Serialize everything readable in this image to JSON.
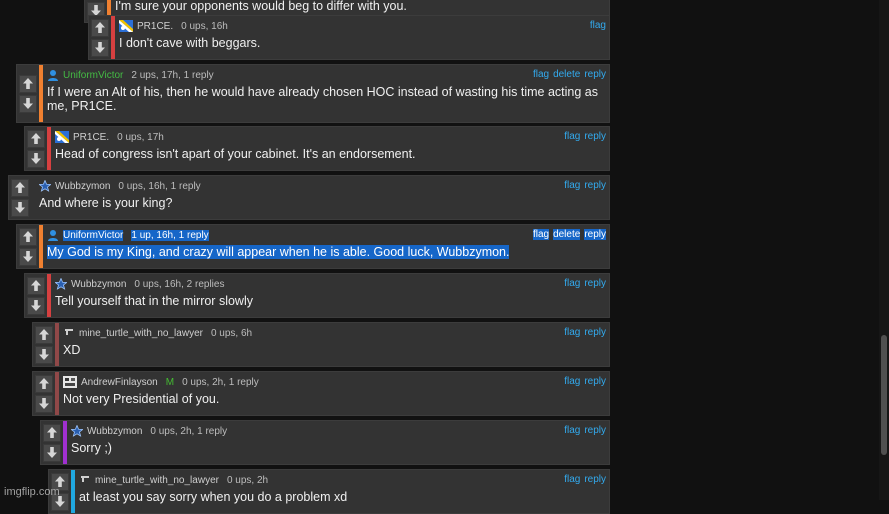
{
  "colors": {
    "background": "#111111",
    "card": "#333333",
    "link": "#33aaee",
    "highlight": "#1666c8",
    "username_uv": "#44bb44",
    "bar_orange": "#f08030",
    "bar_red": "#d64040",
    "bar_darkred": "#904848",
    "bar_purple": "#a030d0",
    "bar_cyan": "#20a8e0"
  },
  "comments": [
    {
      "username": "",
      "stats": "",
      "text": "I'm sure your opponents would beg to differ with you.",
      "actions": []
    },
    {
      "username": "PR1CE.",
      "icon": "flag-avatar-icon",
      "stats": "0 ups, 16h",
      "text": "I don't cave with beggars.",
      "actions": [
        "flag"
      ]
    },
    {
      "username": "UniformVictor",
      "icon": "user-icon",
      "stats": "2 ups, 17h, 1 reply",
      "text": "If I were an Alt of his, then he would have already chosen HOC instead of wasting his time acting as me, PR1CE.",
      "actions": [
        "flag",
        "delete",
        "reply"
      ]
    },
    {
      "username": "PR1CE.",
      "icon": "flag-avatar-icon",
      "stats": "0 ups, 17h",
      "text": "Head of congress isn't apart of your cabinet. It's an endorsement.",
      "actions": [
        "flag",
        "reply"
      ]
    },
    {
      "username": "Wubbzymon",
      "icon": "star-avatar-icon",
      "stats": "0 ups, 16h, 1 reply",
      "text": "And where is your king?",
      "actions": [
        "flag",
        "reply"
      ]
    },
    {
      "username": "UniformVictor",
      "icon": "user-icon",
      "stats": "1 up, 16h, 1 reply",
      "text": "My God is my King, and crazy will appear when he is able. Good luck, Wubbzymon.",
      "actions": [
        "flag",
        "delete",
        "reply"
      ],
      "highlighted": true
    },
    {
      "username": "Wubbzymon",
      "icon": "star-avatar-icon",
      "stats": "0 ups, 16h, 2 replies",
      "text": "Tell yourself that in the mirror slowly",
      "actions": [
        "flag",
        "reply"
      ]
    },
    {
      "username": "mine_turtle_with_no_lawyer",
      "icon": "gun-avatar-icon",
      "stats": "0 ups, 6h",
      "text": "XD",
      "actions": [
        "flag",
        "reply"
      ]
    },
    {
      "username": "AndrewFinlayson",
      "icon": "comic-avatar-icon",
      "badge": "M",
      "stats": "0 ups, 2h, 1 reply",
      "text": "Not very Presidential of you.",
      "actions": [
        "flag",
        "reply"
      ]
    },
    {
      "username": "Wubbzymon",
      "icon": "star-avatar-icon",
      "stats": "0 ups, 2h, 1 reply",
      "text": "Sorry ;)",
      "actions": [
        "flag",
        "reply"
      ]
    },
    {
      "username": "mine_turtle_with_no_lawyer",
      "icon": "gun-avatar-icon",
      "stats": "0 ups, 2h",
      "text": "at least you say sorry when you do a problem xd",
      "actions": [
        "flag",
        "reply"
      ]
    }
  ],
  "watermark": "imgflip.com"
}
